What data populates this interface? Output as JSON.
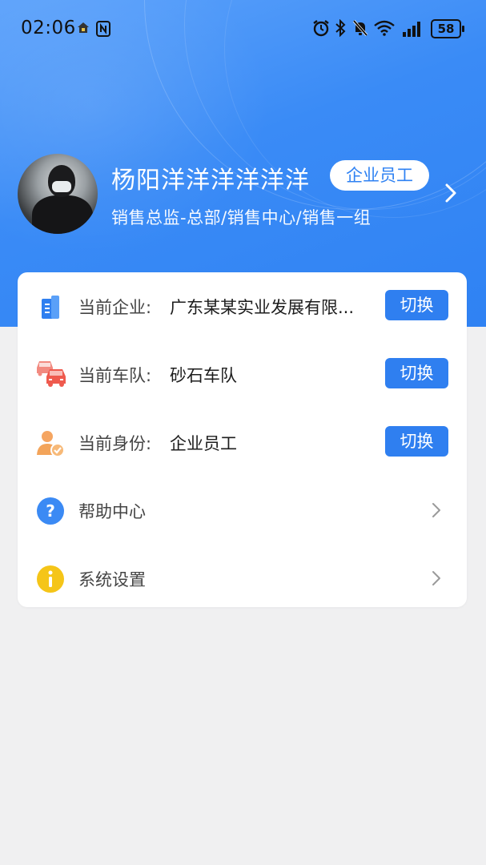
{
  "status_bar": {
    "time": "02:06",
    "battery": "58",
    "icons": [
      "home-app-icon",
      "nfc-icon",
      "alarm-icon",
      "bluetooth-icon",
      "mute-icon",
      "wifi-icon",
      "signal-icon",
      "battery-icon"
    ]
  },
  "profile": {
    "name": "杨阳洋洋洋洋洋洋",
    "role_badge": "企业员工",
    "position": "销售总监-总部/销售中心/销售一组"
  },
  "menu": {
    "company_label": "当前企业:",
    "company_value": "广东某某实业发展有限...",
    "fleet_label": "当前车队:",
    "fleet_value": "砂石车队",
    "identity_label": "当前身份:",
    "identity_value": "企业员工",
    "switch_label": "切换",
    "help_label": "帮助中心",
    "settings_label": "系统设置"
  },
  "colors": {
    "primary": "#2f7ff0",
    "header_gradient_start": "#5ea3fb",
    "header_gradient_end": "#2f82f3",
    "background": "#f0f0f1",
    "fleet_icon": "#ef5a4e",
    "identity_icon": "#f3a45a",
    "help_icon": "#3b8af4",
    "settings_icon": "#f5c518"
  }
}
